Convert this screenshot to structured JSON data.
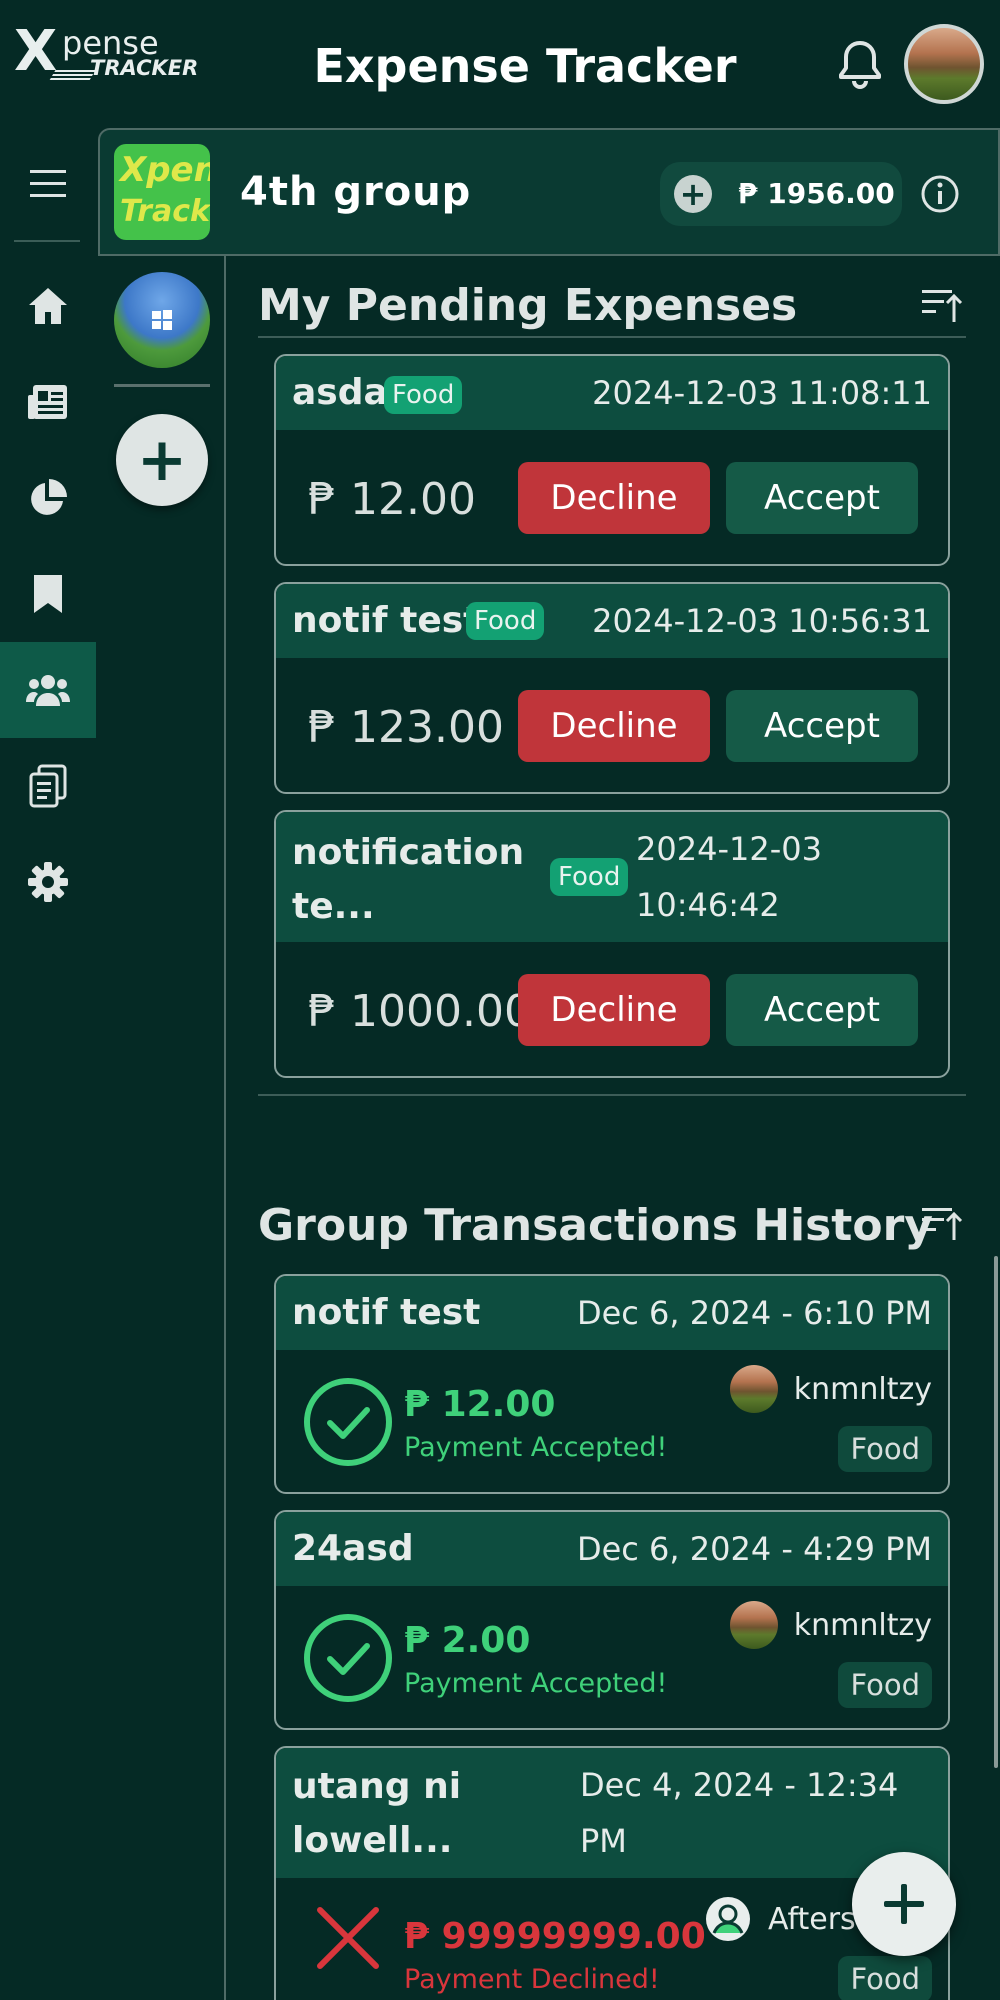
{
  "header": {
    "logo_x": "X",
    "logo_pense": "pense",
    "logo_tracker": "TRACKER",
    "title": "Expense Tracker"
  },
  "nav": {
    "items": [
      {
        "name": "menu",
        "icon": "hamburger-icon"
      },
      {
        "name": "home",
        "icon": "home-icon"
      },
      {
        "name": "news",
        "icon": "newspaper-icon"
      },
      {
        "name": "charts",
        "icon": "pie-chart-icon"
      },
      {
        "name": "bookmarks",
        "icon": "bookmark-icon"
      },
      {
        "name": "groups",
        "icon": "users-icon",
        "active": true
      },
      {
        "name": "reports",
        "icon": "clipboard-icon"
      },
      {
        "name": "settings",
        "icon": "gear-icon"
      }
    ]
  },
  "group": {
    "logo_line1": "Xpen",
    "logo_line2": "Tracke",
    "name": "4th group",
    "balance": "₱ 1956.00"
  },
  "pending": {
    "title": "My Pending Expenses",
    "decline_label": "Decline",
    "accept_label": "Accept",
    "items": [
      {
        "title": "asda",
        "tag": "Food",
        "date": "2024-12-03 11:08:11",
        "amount": "₱ 12.00"
      },
      {
        "title": "notif test",
        "tag": "Food",
        "date": "2024-12-03 10:56:31",
        "amount": "₱ 123.00"
      },
      {
        "title_line1": "notification",
        "title_line2": "te...",
        "tag": "Food",
        "date_line1": "2024-12-03",
        "date_line2": "10:46:42",
        "amount": "₱ 1000.00"
      }
    ]
  },
  "history": {
    "title": "Group Transactions History",
    "items": [
      {
        "title": "notif test",
        "date": "Dec 6, 2024 - 6:10 PM",
        "amount": "₱ 12.00",
        "status": "Payment Accepted!",
        "user": "knmnltzy",
        "tag": "Food",
        "accepted": true
      },
      {
        "title": "24asd",
        "date": "Dec 6, 2024 - 4:29 PM",
        "amount": "₱ 2.00",
        "status": "Payment Accepted!",
        "user": "knmnltzy",
        "tag": "Food",
        "accepted": true
      },
      {
        "title_line1": "utang ni",
        "title_line2": "lowell...",
        "date_line1": "Dec 4, 2024 - 12:34",
        "date_line2": "PM",
        "amount": "₱ 99999999.00",
        "status": "Payment Declined!",
        "user": "Aftershe",
        "tag": "Food",
        "accepted": false
      }
    ]
  },
  "colors": {
    "background": "#052a25",
    "card_header": "#0d4d3f",
    "accept": "#155a47",
    "decline": "#c0353a",
    "tag": "#13a173",
    "success": "#3fd17a",
    "error": "#d9363c"
  }
}
